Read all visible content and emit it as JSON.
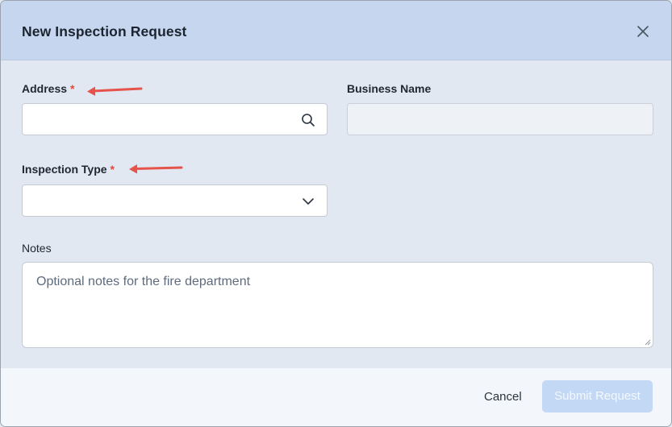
{
  "dialog": {
    "title": "New Inspection Request"
  },
  "fields": {
    "address": {
      "label": "Address",
      "required_mark": "*",
      "value": "",
      "icon": "search-icon"
    },
    "business_name": {
      "label": "Business Name",
      "value": ""
    },
    "inspection_type": {
      "label": "Inspection Type",
      "required_mark": "*",
      "value": "",
      "icon": "chevron-down-icon"
    },
    "notes": {
      "label": "Notes",
      "placeholder": "Optional notes for the fire department"
    }
  },
  "footer": {
    "cancel_label": "Cancel",
    "submit_label": "Submit Request"
  },
  "colors": {
    "header_bg": "#c5d6ee",
    "body_bg": "#e2e8f1",
    "required": "#e5483f",
    "annotation_arrow": "#e5534b",
    "submit_disabled_bg": "#c3d8f5"
  }
}
